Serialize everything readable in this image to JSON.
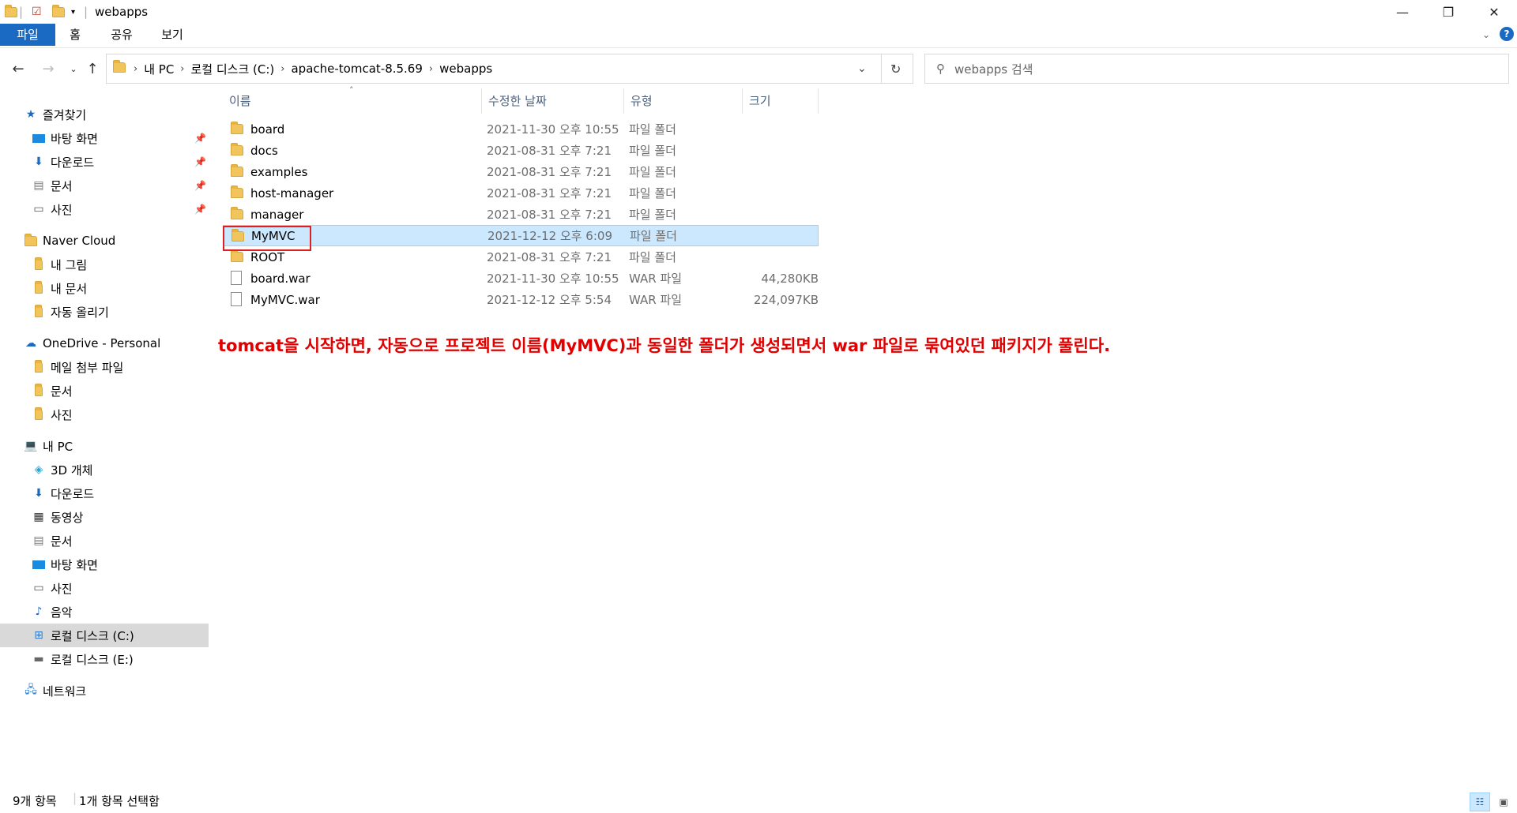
{
  "window": {
    "title": "webapps"
  },
  "ribbon": {
    "tabs": [
      "파일",
      "홈",
      "공유",
      "보기"
    ]
  },
  "address": {
    "crumbs": [
      "내 PC",
      "로컬 디스크 (C:)",
      "apache-tomcat-8.5.69",
      "webapps"
    ],
    "search_placeholder": "webapps 검색"
  },
  "nav_pane": {
    "quick_access": {
      "label": "즐겨찾기",
      "items": [
        "바탕 화면",
        "다운로드",
        "문서",
        "사진"
      ]
    },
    "naver_cloud": {
      "label": "Naver Cloud",
      "items": [
        "내 그림",
        "내 문서",
        "자동 올리기"
      ]
    },
    "onedrive": {
      "label": "OneDrive - Personal",
      "items": [
        "메일 첨부 파일",
        "문서",
        "사진"
      ]
    },
    "this_pc": {
      "label": "내 PC",
      "items": [
        "3D 개체",
        "다운로드",
        "동영상",
        "문서",
        "바탕 화면",
        "사진",
        "음악",
        "로컬 디스크 (C:)",
        "로컬 디스크 (E:)"
      ]
    },
    "network": {
      "label": "네트워크"
    }
  },
  "file_list": {
    "columns": [
      "이름",
      "수정한 날짜",
      "유형",
      "크기"
    ],
    "rows": [
      {
        "name": "board",
        "date": "2021-11-30 오후 10:55",
        "type": "파일 폴더",
        "size": ""
      },
      {
        "name": "docs",
        "date": "2021-08-31 오후 7:21",
        "type": "파일 폴더",
        "size": ""
      },
      {
        "name": "examples",
        "date": "2021-08-31 오후 7:21",
        "type": "파일 폴더",
        "size": ""
      },
      {
        "name": "host-manager",
        "date": "2021-08-31 오후 7:21",
        "type": "파일 폴더",
        "size": ""
      },
      {
        "name": "manager",
        "date": "2021-08-31 오후 7:21",
        "type": "파일 폴더",
        "size": ""
      },
      {
        "name": "MyMVC",
        "date": "2021-12-12 오후 6:09",
        "type": "파일 폴더",
        "size": ""
      },
      {
        "name": "ROOT",
        "date": "2021-08-31 오후 7:21",
        "type": "파일 폴더",
        "size": ""
      },
      {
        "name": "board.war",
        "date": "2021-11-30 오후 10:55",
        "type": "WAR 파일",
        "size": "44,280KB"
      },
      {
        "name": "MyMVC.war",
        "date": "2021-12-12 오후 5:54",
        "type": "WAR 파일",
        "size": "224,097KB"
      }
    ]
  },
  "annotation": "tomcat을 시작하면, 자동으로 프로젝트 이름(MyMVC)과 동일한 폴더가 생성되면서 war 파일로 묶여있던 패키지가 풀린다.",
  "status": {
    "count": "9개 항목",
    "selected": "1개 항목 선택함"
  },
  "colors": {
    "accent": "#1a69c2",
    "selection": "#cce8ff",
    "annotation": "#e00000"
  }
}
